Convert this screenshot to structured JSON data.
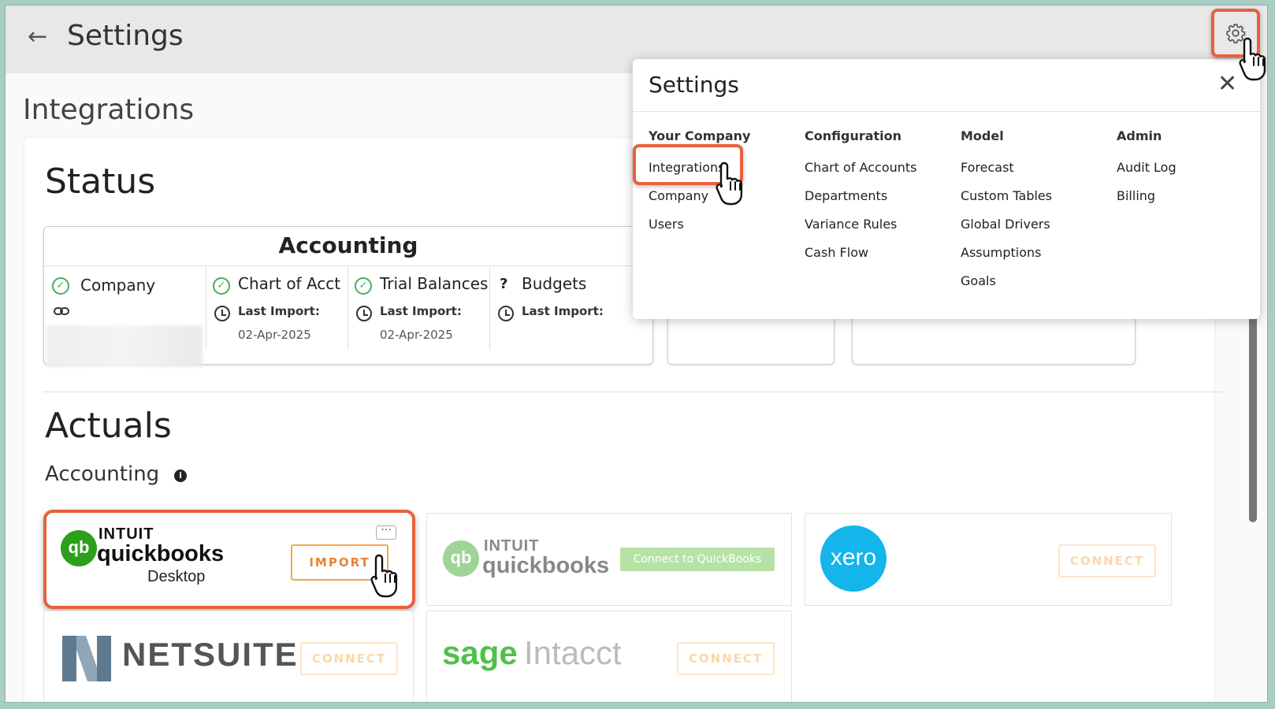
{
  "topbar": {
    "back_icon": "←",
    "title": "Settings"
  },
  "page_title": "Integrations",
  "status": {
    "title": "Status",
    "accounting": {
      "heading": "Accounting",
      "items": [
        {
          "name": "Company",
          "status": "ok"
        },
        {
          "name": "Chart of Acct",
          "status": "ok",
          "last_import_label": "Last Import:",
          "last_import_date": "02-Apr-2025"
        },
        {
          "name": "Trial Balances",
          "status": "ok",
          "last_import_label": "Last Import:",
          "last_import_date": "02-Apr-2025"
        },
        {
          "name": "Budgets",
          "status": "unknown",
          "last_import_label": "Last Import:"
        }
      ]
    }
  },
  "actuals": {
    "title": "Actuals",
    "subtitle": "Accounting",
    "integrations": [
      {
        "brand_line1": "INTUIT",
        "brand_line2": "quickbooks",
        "brand_line3": "Desktop",
        "button": "IMPORT",
        "menu": "···"
      },
      {
        "brand_line1": "INTUIT",
        "brand_line2": "quickbooks",
        "button": "Connect to QuickBooks"
      },
      {
        "brand": "xero",
        "button": "CONNECT"
      },
      {
        "brand": "NETSUITE",
        "button": "CONNECT"
      },
      {
        "brand_part1": "sage",
        "brand_part2": "Intacct",
        "button": "CONNECT"
      }
    ]
  },
  "popup": {
    "title": "Settings",
    "close_icon": "✕",
    "columns": [
      {
        "heading": "Your Company",
        "items": [
          "Integrations",
          "Company",
          "Users"
        ]
      },
      {
        "heading": "Configuration",
        "items": [
          "Chart of Accounts",
          "Departments",
          "Variance Rules",
          "Cash Flow"
        ]
      },
      {
        "heading": "Model",
        "items": [
          "Forecast",
          "Custom Tables",
          "Global Drivers",
          "Assumptions",
          "Goals"
        ]
      },
      {
        "heading": "Admin",
        "items": [
          "Audit Log",
          "Billing"
        ]
      }
    ]
  },
  "colors": {
    "highlight": "#e8603c",
    "qb_green": "#2ca01c",
    "xero_blue": "#13b5ea",
    "import_orange": "#e8823a"
  }
}
